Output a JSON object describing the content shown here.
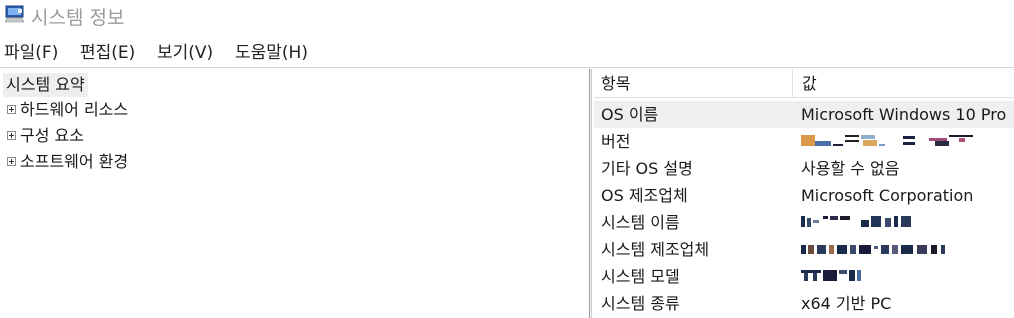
{
  "window": {
    "title": "시스템 정보",
    "icon": "system-information-icon"
  },
  "menu": [
    {
      "label": "파일(F)"
    },
    {
      "label": "편집(E)"
    },
    {
      "label": "보기(V)"
    },
    {
      "label": "도움말(H)"
    }
  ],
  "tree": {
    "root": "시스템 요약",
    "nodes": [
      {
        "label": "하드웨어 리소스",
        "icon": "expand-plus-icon"
      },
      {
        "label": "구성 요소",
        "icon": "expand-plus-icon"
      },
      {
        "label": "소프트웨어 환경",
        "icon": "expand-plus-icon"
      }
    ]
  },
  "table": {
    "headers": {
      "item": "항목",
      "value": "값"
    },
    "rows": [
      {
        "item": "OS 이름",
        "value": "Microsoft Windows 10 Pro",
        "selected": true
      },
      {
        "item": "버전",
        "value": null,
        "redacted": true
      },
      {
        "item": "기타 OS 설명",
        "value": "사용할 수 없음"
      },
      {
        "item": "OS 제조업체",
        "value": "Microsoft Corporation"
      },
      {
        "item": "시스템 이름",
        "value": null,
        "redacted": true
      },
      {
        "item": "시스템 제조업체",
        "value": null,
        "redacted": true
      },
      {
        "item": "시스템 모델",
        "value": null,
        "redacted": true
      },
      {
        "item": "시스템 종류",
        "value": "x64 기반 PC"
      }
    ]
  },
  "colors": {
    "selection": "#efefef",
    "divider": "#a0a0a0",
    "title_text": "#9a9a9a"
  }
}
